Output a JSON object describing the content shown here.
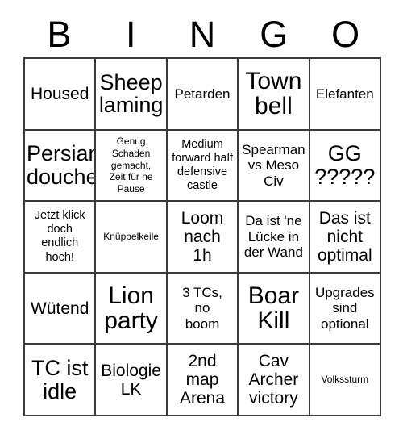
{
  "header": {
    "letters": [
      "B",
      "I",
      "N",
      "G",
      "O"
    ]
  },
  "grid": {
    "rows": 5,
    "columns": 5,
    "border_color": "#3a3a3a",
    "background_color": "#ffffff",
    "text_color": "#000000",
    "cells": [
      {
        "text": "Housed",
        "size": "l"
      },
      {
        "text": "Sheep\nlaming",
        "size": "xl"
      },
      {
        "text": "Petarden",
        "size": "m"
      },
      {
        "text": "Town\nbell",
        "size": "xxl"
      },
      {
        "text": "Elefanten",
        "size": "m"
      },
      {
        "text": "Persian\ndouche",
        "size": "xl"
      },
      {
        "text": "Genug\nSchaden\ngemacht,\nZeit für ne\nPause",
        "size": "xs"
      },
      {
        "text": "Medium\nforward half\ndefensive\ncastle",
        "size": "s"
      },
      {
        "text": "Spearman\nvs Meso\nCiv",
        "size": "m"
      },
      {
        "text": "GG\n?????",
        "size": "xl"
      },
      {
        "text": "Jetzt klick\ndoch\nendlich\nhoch!",
        "size": "s"
      },
      {
        "text": "Knüppelkeile",
        "size": "xs"
      },
      {
        "text": "Loom\nnach\n1h",
        "size": "l"
      },
      {
        "text": "Da ist 'ne\nLücke in\nder Wand",
        "size": "m"
      },
      {
        "text": "Das ist\nnicht\noptimal",
        "size": "l"
      },
      {
        "text": "Wütend",
        "size": "l"
      },
      {
        "text": "Lion\nparty",
        "size": "xxl"
      },
      {
        "text": "3 TCs,\nno\nboom",
        "size": "m"
      },
      {
        "text": "Boar\nKill",
        "size": "xxl"
      },
      {
        "text": "Upgrades\nsind\noptional",
        "size": "m"
      },
      {
        "text": "TC ist\nidle",
        "size": "xl"
      },
      {
        "text": "Biologie\nLK",
        "size": "l"
      },
      {
        "text": "2nd\nmap\nArena",
        "size": "l"
      },
      {
        "text": "Cav\nArcher\nvictory",
        "size": "l"
      },
      {
        "text": "Volkssturm",
        "size": "xs"
      }
    ]
  }
}
